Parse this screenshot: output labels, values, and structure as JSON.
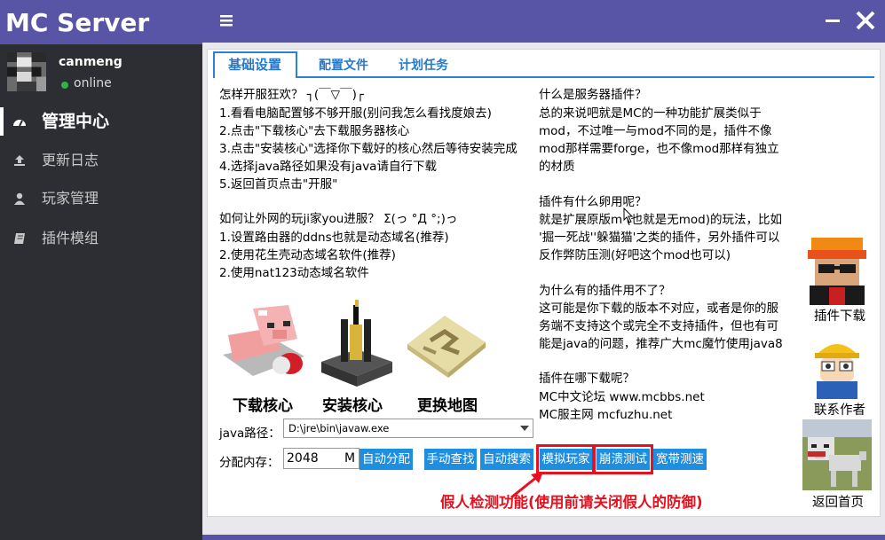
{
  "app": {
    "title": "MC Server"
  },
  "user": {
    "name": "canmeng",
    "status": "online"
  },
  "nav": {
    "dashboard": "管理中心",
    "changelog": "更新日志",
    "players": "玩家管理",
    "plugins": "插件模组"
  },
  "tabs": {
    "basic": "基础设置",
    "config": "配置文件",
    "tasks": "计划任务"
  },
  "guide": {
    "q1": "怎样开服狂欢？ ┐(￣▽￣)┌",
    "s1": "1.看看电脑配置够不够开服(别问我怎么看找度娘去)",
    "s2": "2.点击\"下载核心\"去下载服务器核心",
    "s3": "3.点击\"安装核心\"选择你下载好的核心然后等待安装完成",
    "s4": "4.选择java路径如果没有java请自行下载",
    "s5": "5.返回首页点击\"开服\"",
    "q2": "如何让外网的玩ji家you进服？  Σ(っ °Д °;)っ",
    "t1": "1.设置路由器的ddns也就是动态域名(推荐)",
    "t2": "2.使用花生壳动态域名软件(推荐)",
    "t3": "2.使用nat123动态域名软件"
  },
  "faq": {
    "q1": "什么是服务器插件？",
    "a1_1": "总的来说吧就是MC的一种功能扩展类似于",
    "a1_2": "mod，不过唯一与mod不同的是，插件不像",
    "a1_3": "mod那样需要forge，也不像mod那样有独立",
    "a1_4": "的材质",
    "q2": "插件有什么卵用呢？",
    "a2_1": "就是扩展原版m (也就是无mod)的玩法，比如",
    "a2_2": "'掘一死战''躲猫猫'之类的插件，另外插件可以",
    "a2_3": "反作弊防压测(好吧这个mod也可以)",
    "q3": "为什么有的插件用不了？",
    "a3_1": "这可能是你下载的版本不对应，或者是你的服",
    "a3_2": "务端不支持这个或完全不支持插件，但也有可",
    "a3_3": "能是java的问题，推荐广大mc魔竹使用java8",
    "q4": "插件在哪下载呢？",
    "a4_1": "MC中文论坛 www.mcbbs.net",
    "a4_2": "MC服主网 mcfuzhu.net"
  },
  "actions": {
    "download_core": "下载核心",
    "install_core": "安装核心",
    "change_map": "更换地图"
  },
  "settings": {
    "java_label": "java路径：",
    "java_path": "D:\\jre\\bin\\javaw.exe",
    "mem_label": "分配内存：",
    "mem_value": "2048",
    "mem_unit": "M"
  },
  "buttons": {
    "auto_alloc": "自动分配",
    "manual_find": "手动查找",
    "auto_search": "自动搜索",
    "sim_player": "模拟玩家",
    "crash_test": "崩溃测试",
    "bandwidth": "宽带测速"
  },
  "annotation": "假人检测功能(使用前请关闭假人的防御)",
  "side": {
    "plugin_download": "插件下载",
    "contact_author": "联系作者",
    "back_home": "返回首页"
  },
  "colors": {
    "brand": "#5955a6",
    "sidebar": "#2d2e33",
    "accent": "#1e8fe0",
    "alert": "#e8101c"
  }
}
